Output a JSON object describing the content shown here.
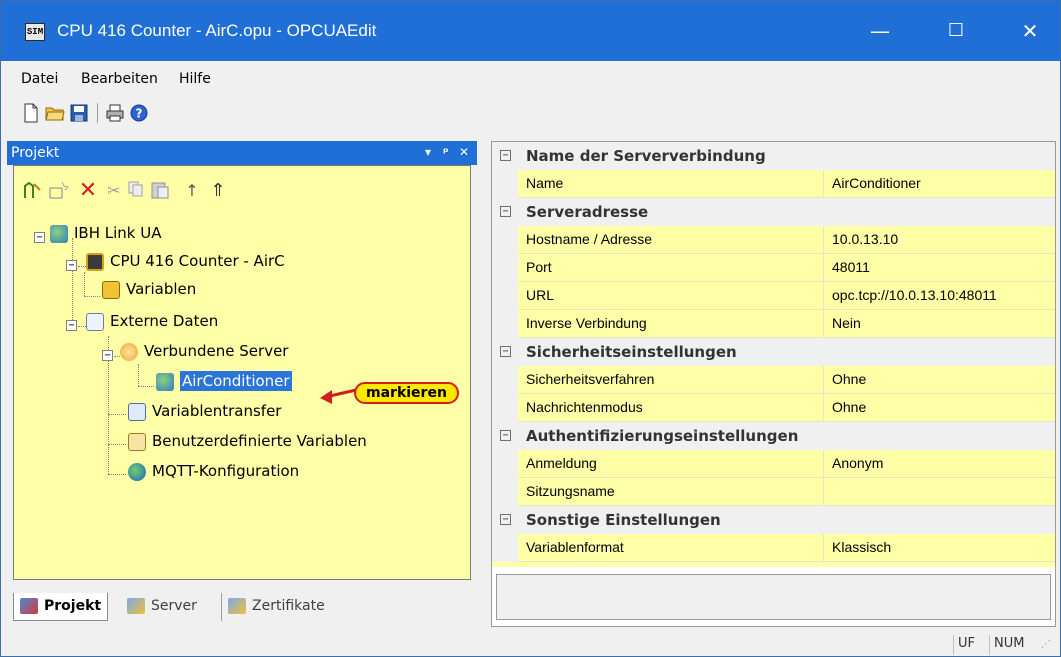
{
  "window": {
    "title": "CPU 416 Counter - AirC.opu - OPCUAEdit",
    "app_icon_text": "SIM",
    "minimize_symbol": "—",
    "maximize_symbol": "☐",
    "close_symbol": "✕"
  },
  "menu": {
    "items": [
      {
        "label": "Datei"
      },
      {
        "label": "Bearbeiten"
      },
      {
        "label": "Hilfe"
      }
    ]
  },
  "toolbar": {
    "icons": [
      "new-file-icon",
      "open-folder-icon",
      "save-icon",
      "print-icon",
      "help-icon"
    ]
  },
  "project_panel": {
    "title": "Projekt",
    "header_buttons": [
      "▾",
      "ᵖ",
      "✕"
    ],
    "toolbar_icons": [
      "add-server-icon",
      "add-item-icon",
      "delete-icon",
      "cut-icon",
      "copy-icon",
      "paste-icon",
      "move-up-icon",
      "move-top-icon"
    ],
    "tree": [
      {
        "label": "IBH Link UA",
        "icon": "globe-server-icon"
      },
      {
        "label": "CPU 416 Counter - AirC",
        "icon": "cpu-icon"
      },
      {
        "label": "Variablen",
        "icon": "variables-icon"
      },
      {
        "label": "Externe Daten",
        "icon": "external-data-icon"
      },
      {
        "label": "Verbundene Server",
        "icon": "connected-servers-icon"
      },
      {
        "label": "AirConditioner",
        "icon": "server-globe-icon"
      },
      {
        "label": "Variablentransfer",
        "icon": "transfer-icon"
      },
      {
        "label": "Benutzerdefinierte Variablen",
        "icon": "user-variables-icon"
      },
      {
        "label": "MQTT-Konfiguration",
        "icon": "mqtt-icon"
      }
    ],
    "callout": "markieren",
    "tabs": [
      {
        "label": "Projekt"
      },
      {
        "label": "Server"
      },
      {
        "label": "Zertifikate"
      }
    ]
  },
  "properties": {
    "categories": [
      {
        "title": "Name der Serververbindung",
        "rows": [
          {
            "name": "Name",
            "value": "AirConditioner"
          }
        ]
      },
      {
        "title": "Serveradresse",
        "rows": [
          {
            "name": "Hostname / Adresse",
            "value": "10.0.13.10"
          },
          {
            "name": "Port",
            "value": "48011"
          },
          {
            "name": "URL",
            "value": "opc.tcp://10.0.13.10:48011"
          },
          {
            "name": "Inverse Verbindung",
            "value": "Nein"
          }
        ]
      },
      {
        "title": "Sicherheitseinstellungen",
        "rows": [
          {
            "name": "Sicherheitsverfahren",
            "value": "Ohne"
          },
          {
            "name": "Nachrichtenmodus",
            "value": "Ohne"
          }
        ]
      },
      {
        "title": "Authentifizierungseinstellungen",
        "rows": [
          {
            "name": "Anmeldung",
            "value": "Anonym"
          },
          {
            "name": "Sitzungsname",
            "value": ""
          }
        ]
      },
      {
        "title": "Sonstige Einstellungen",
        "rows": [
          {
            "name": "Variablenformat",
            "value": "Klassisch"
          }
        ]
      }
    ],
    "collapse_symbol": "−"
  },
  "statusbar": {
    "uf": "UF",
    "num": "NUM"
  }
}
